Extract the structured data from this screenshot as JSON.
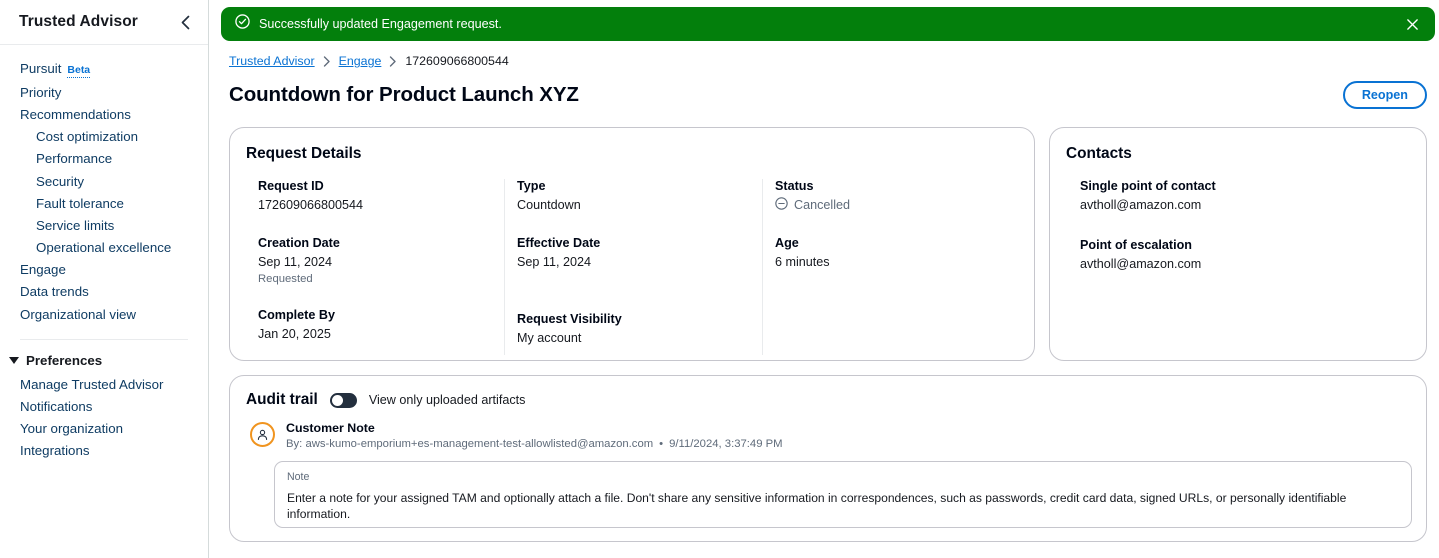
{
  "sidebar": {
    "title": "Trusted Advisor",
    "collapse_icon": "chevron-left-icon",
    "items": [
      {
        "label": "Pursuit",
        "badge": "Beta",
        "child": false
      },
      {
        "label": "Priority",
        "child": false
      },
      {
        "label": "Recommendations",
        "child": false
      },
      {
        "label": "Cost optimization",
        "child": true
      },
      {
        "label": "Performance",
        "child": true
      },
      {
        "label": "Security",
        "child": true
      },
      {
        "label": "Fault tolerance",
        "child": true
      },
      {
        "label": "Service limits",
        "child": true
      },
      {
        "label": "Operational excellence",
        "child": true
      },
      {
        "label": "Engage",
        "child": false
      },
      {
        "label": "Data trends",
        "child": false
      },
      {
        "label": "Organizational view",
        "child": false
      }
    ],
    "preferences": {
      "label": "Preferences",
      "caret_icon": "caret-down-icon",
      "items": [
        {
          "label": "Manage Trusted Advisor"
        },
        {
          "label": "Notifications"
        },
        {
          "label": "Your organization"
        },
        {
          "label": "Integrations"
        }
      ]
    }
  },
  "flashbar": {
    "status_icon": "success-check-circle-icon",
    "message": "Successfully updated Engagement request.",
    "close_icon": "close-icon",
    "background_color": "#037f0c"
  },
  "breadcrumb": {
    "items": [
      {
        "label": "Trusted Advisor",
        "current": false
      },
      {
        "label": "Engage",
        "current": false
      },
      {
        "label": "172609066800544",
        "current": true
      }
    ],
    "separator_icon": "chevron-right-icon"
  },
  "header": {
    "title": "Countdown for Product Launch XYZ",
    "action_label": "Reopen",
    "action_color": "#0972d3"
  },
  "request_details": {
    "title": "Request Details",
    "columns": [
      {
        "fields": [
          {
            "label": "Request ID",
            "value": "172609066800544"
          },
          {
            "label": "Creation Date",
            "value": "Sep 11, 2024",
            "sub": "Requested"
          },
          {
            "label": "Complete By",
            "value": "Jan 20, 2025"
          }
        ]
      },
      {
        "fields": [
          {
            "label": "Type",
            "value": "Countdown"
          },
          {
            "label": "Effective Date",
            "value": "Sep 11, 2024"
          },
          {
            "label": "Request Visibility",
            "value": "My account"
          }
        ]
      },
      {
        "fields": [
          {
            "label": "Status",
            "value": "Cancelled",
            "icon": "cancelled-circle-minus-icon"
          },
          {
            "label": "Age",
            "value": "6 minutes"
          }
        ]
      }
    ]
  },
  "contacts": {
    "title": "Contacts",
    "fields": [
      {
        "label": "Single point of contact",
        "value": "avtholl@amazon.com"
      },
      {
        "label": "Point of escalation",
        "value": "avtholl@amazon.com"
      }
    ]
  },
  "audit_trail": {
    "title": "Audit trail",
    "toggle_label": "View only uploaded artifacts",
    "toggle_on": false,
    "entry": {
      "avatar_icon": "user-avatar-icon",
      "avatar_color": "#f0941f",
      "title": "Customer Note",
      "meta_author": "By: aws-kumo-emporium+es-management-test-allowlisted@amazon.com",
      "meta_separator": "•",
      "meta_timestamp": "9/11/2024, 3:37:49 PM",
      "note_label": "Note",
      "note_text": "Enter a note for your assigned TAM and optionally attach a file. Don't share any sensitive information in correspondences, such as passwords, credit card data, signed URLs, or personally identifiable information."
    }
  }
}
